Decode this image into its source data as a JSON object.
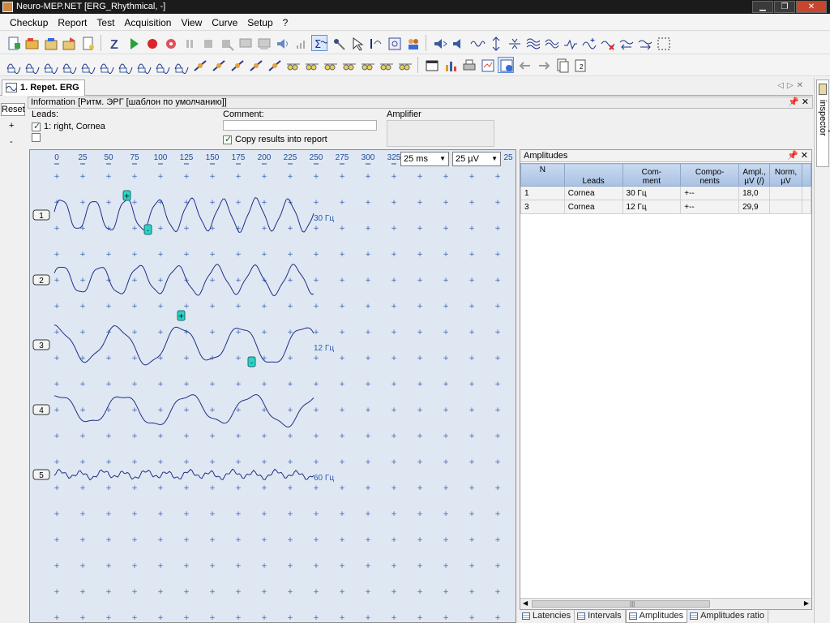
{
  "window": {
    "title": "Neuro-MEP.NET [ERG_Rhythmical, -]"
  },
  "menu": [
    "Checkup",
    "Report",
    "Test",
    "Acquisition",
    "View",
    "Curve",
    "Setup",
    "?"
  ],
  "document_tab": {
    "label": "1. Repet. ERG"
  },
  "left_strip": {
    "reset": "Reset",
    "plus": "+",
    "minus": "-"
  },
  "info": {
    "title": "Information [Ритм. ЭРГ [шаблон по умолчанию]]",
    "leads_label": "Leads:",
    "lead_item": "1: right, Cornea",
    "comment_label": "Comment:",
    "comment_value": "",
    "copy_label": "Copy results into report",
    "amplifier_label": "Amplifier"
  },
  "plot": {
    "time_ticks": [
      "0",
      "25",
      "50",
      "75",
      "100",
      "125",
      "150",
      "175",
      "200",
      "225",
      "250",
      "275",
      "300",
      "325"
    ],
    "time_scale": "25 ms",
    "amp_scale": "25 µV",
    "channels": [
      {
        "num": "1",
        "label": "30 Гц"
      },
      {
        "num": "2",
        "label": ""
      },
      {
        "num": "3",
        "label": "12 Гц"
      },
      {
        "num": "4",
        "label": ""
      },
      {
        "num": "5",
        "label": "60 Гц"
      }
    ],
    "marker_plus": "+",
    "marker_minus": "-"
  },
  "amplitudes": {
    "title": "Amplitudes",
    "columns": [
      "N",
      "Leads",
      "Com-\nment",
      "Compo-\nnents",
      "Ampl.,\nµV (/)",
      "Norm,\nµV"
    ],
    "rows": [
      {
        "n": "1",
        "leads": "Cornea",
        "comment": "30 Гц",
        "components": "+--",
        "ampl": "18,0",
        "norm": ""
      },
      {
        "n": "3",
        "leads": "Cornea",
        "comment": "12 Гц",
        "components": "+--",
        "ampl": "29,9",
        "norm": ""
      }
    ]
  },
  "bottom_tabs": [
    "Latencies",
    "Intervals",
    "Amplitudes",
    "Amplitudes ratio"
  ],
  "inspector": {
    "label": "Checkup inspector"
  },
  "colors": {
    "trace": "#1f2f8a",
    "plot_bg": "#dfe8f2",
    "grid_plus": "#3d63b8",
    "marker": "#2ad3c8",
    "header": "#b7cde9"
  }
}
